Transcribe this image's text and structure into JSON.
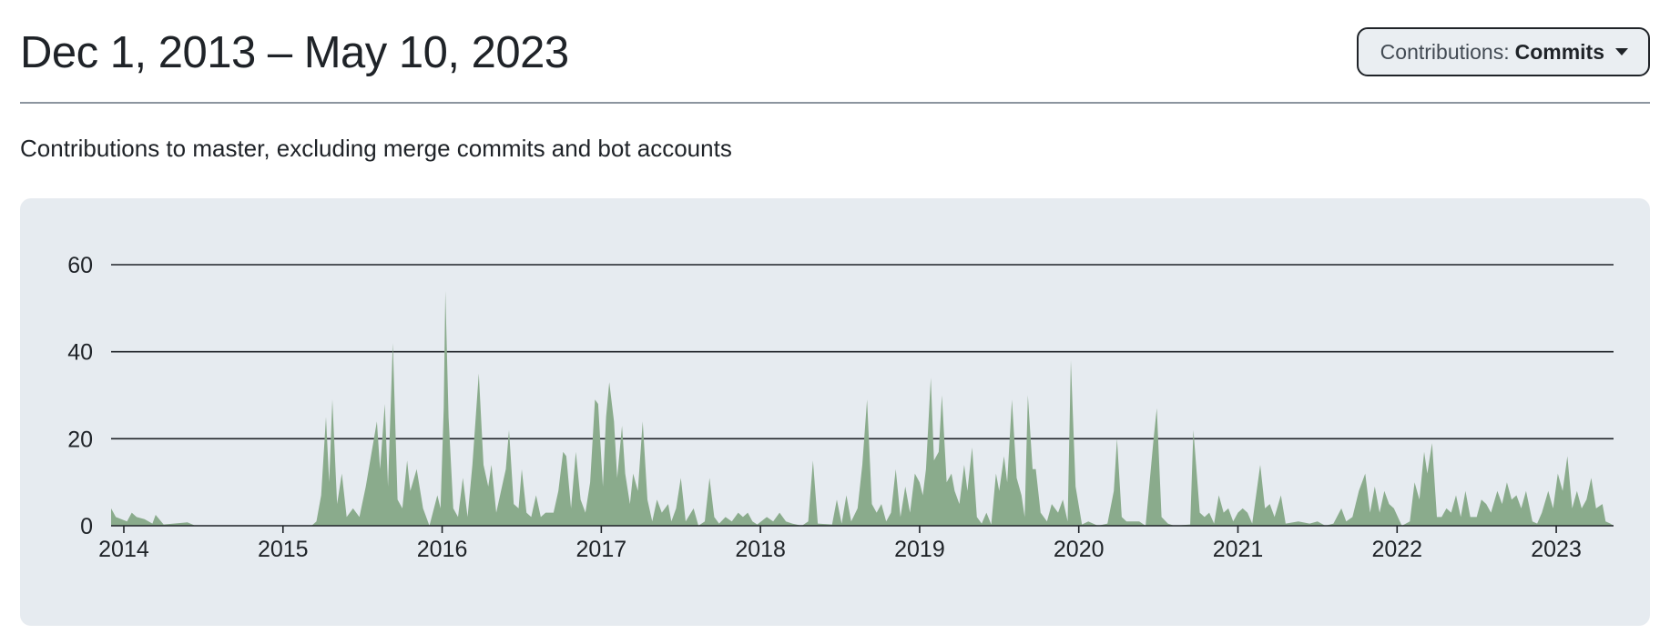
{
  "header": {
    "date_range": "Dec 1, 2013 – May 10, 2023",
    "dropdown": {
      "label": "Contributions:",
      "value": "Commits",
      "icon": "caret-down-icon"
    }
  },
  "subtitle": "Contributions to master, excluding merge commits and bot accounts",
  "colors": {
    "area": "#8aab8c",
    "panel": "#e6ebf0",
    "grid": "#1f2328"
  },
  "chart_data": {
    "type": "area",
    "title": "",
    "xlabel": "",
    "ylabel": "",
    "xlim": [
      2013.92,
      2023.36
    ],
    "ylim": [
      0,
      60
    ],
    "grid": true,
    "legend": "none",
    "y_ticks": [
      0,
      20,
      40,
      60
    ],
    "x_ticks": [
      2014,
      2015,
      2016,
      2017,
      2018,
      2019,
      2020,
      2021,
      2022,
      2023
    ],
    "x_tick_labels": [
      "2014",
      "2015",
      "2016",
      "2017",
      "2018",
      "2019",
      "2020",
      "2021",
      "2022",
      "2023"
    ],
    "series": [
      {
        "values": [
          [
            2013.92,
            4
          ],
          [
            2013.95,
            2
          ],
          [
            2014.02,
            1
          ],
          [
            2014.05,
            3
          ],
          [
            2014.08,
            2
          ],
          [
            2014.13,
            1.5
          ],
          [
            2014.18,
            0.5
          ],
          [
            2014.2,
            2.5
          ],
          [
            2014.25,
            0.3
          ],
          [
            2014.4,
            0.8
          ],
          [
            2014.45,
            0
          ],
          [
            2015.18,
            0
          ],
          [
            2015.21,
            1
          ],
          [
            2015.24,
            7
          ],
          [
            2015.27,
            25
          ],
          [
            2015.29,
            10
          ],
          [
            2015.31,
            29
          ],
          [
            2015.34,
            5
          ],
          [
            2015.37,
            12
          ],
          [
            2015.4,
            2
          ],
          [
            2015.44,
            4
          ],
          [
            2015.48,
            2
          ],
          [
            2015.52,
            9
          ],
          [
            2015.59,
            24
          ],
          [
            2015.61,
            13
          ],
          [
            2015.64,
            28
          ],
          [
            2015.66,
            9
          ],
          [
            2015.69,
            42
          ],
          [
            2015.72,
            6
          ],
          [
            2015.75,
            4
          ],
          [
            2015.78,
            15
          ],
          [
            2015.8,
            8
          ],
          [
            2015.84,
            13
          ],
          [
            2015.88,
            4
          ],
          [
            2015.92,
            0
          ],
          [
            2015.97,
            7
          ],
          [
            2015.99,
            4
          ],
          [
            2016.01,
            27
          ],
          [
            2016.02,
            54
          ],
          [
            2016.04,
            25
          ],
          [
            2016.07,
            4
          ],
          [
            2016.1,
            2
          ],
          [
            2016.13,
            11
          ],
          [
            2016.16,
            2
          ],
          [
            2016.19,
            14
          ],
          [
            2016.23,
            35
          ],
          [
            2016.26,
            14
          ],
          [
            2016.29,
            9
          ],
          [
            2016.31,
            14
          ],
          [
            2016.34,
            3
          ],
          [
            2016.37,
            8
          ],
          [
            2016.4,
            13
          ],
          [
            2016.42,
            22
          ],
          [
            2016.45,
            5
          ],
          [
            2016.48,
            4
          ],
          [
            2016.5,
            13
          ],
          [
            2016.53,
            3
          ],
          [
            2016.56,
            2
          ],
          [
            2016.59,
            7
          ],
          [
            2016.62,
            2
          ],
          [
            2016.65,
            3
          ],
          [
            2016.7,
            3
          ],
          [
            2016.73,
            8
          ],
          [
            2016.76,
            17
          ],
          [
            2016.78,
            16
          ],
          [
            2016.81,
            4
          ],
          [
            2016.84,
            17
          ],
          [
            2016.87,
            6
          ],
          [
            2016.9,
            3
          ],
          [
            2016.93,
            10
          ],
          [
            2016.96,
            29
          ],
          [
            2016.98,
            28
          ],
          [
            2017.01,
            9
          ],
          [
            2017.03,
            25
          ],
          [
            2017.05,
            33
          ],
          [
            2017.08,
            24
          ],
          [
            2017.1,
            11
          ],
          [
            2017.13,
            23
          ],
          [
            2017.15,
            12
          ],
          [
            2017.18,
            5
          ],
          [
            2017.2,
            12
          ],
          [
            2017.23,
            8
          ],
          [
            2017.26,
            24
          ],
          [
            2017.29,
            6
          ],
          [
            2017.32,
            1
          ],
          [
            2017.35,
            6
          ],
          [
            2017.38,
            3
          ],
          [
            2017.42,
            5
          ],
          [
            2017.44,
            1
          ],
          [
            2017.47,
            4
          ],
          [
            2017.5,
            11
          ],
          [
            2017.53,
            1
          ],
          [
            2017.58,
            4
          ],
          [
            2017.61,
            0
          ],
          [
            2017.65,
            1
          ],
          [
            2017.68,
            11
          ],
          [
            2017.71,
            2
          ],
          [
            2017.74,
            0.5
          ],
          [
            2017.78,
            2
          ],
          [
            2017.82,
            1
          ],
          [
            2017.86,
            3
          ],
          [
            2017.89,
            2
          ],
          [
            2017.92,
            3
          ],
          [
            2017.95,
            1
          ],
          [
            2017.98,
            0.3
          ],
          [
            2018.04,
            2
          ],
          [
            2018.08,
            1
          ],
          [
            2018.12,
            3
          ],
          [
            2018.16,
            1
          ],
          [
            2018.2,
            0.5
          ],
          [
            2018.26,
            0
          ],
          [
            2018.3,
            1
          ],
          [
            2018.33,
            15
          ],
          [
            2018.36,
            0.5
          ],
          [
            2018.45,
            0.3
          ],
          [
            2018.48,
            6
          ],
          [
            2018.51,
            0.5
          ],
          [
            2018.54,
            7
          ],
          [
            2018.57,
            1
          ],
          [
            2018.61,
            4
          ],
          [
            2018.64,
            14
          ],
          [
            2018.67,
            29
          ],
          [
            2018.7,
            5
          ],
          [
            2018.73,
            3
          ],
          [
            2018.76,
            5
          ],
          [
            2018.79,
            1
          ],
          [
            2018.82,
            3
          ],
          [
            2018.85,
            13
          ],
          [
            2018.88,
            2
          ],
          [
            2018.91,
            9
          ],
          [
            2018.94,
            3
          ],
          [
            2018.97,
            12
          ],
          [
            2019,
            10
          ],
          [
            2019.02,
            7
          ],
          [
            2019.04,
            13
          ],
          [
            2019.07,
            34
          ],
          [
            2019.09,
            15
          ],
          [
            2019.12,
            17
          ],
          [
            2019.14,
            30
          ],
          [
            2019.17,
            10
          ],
          [
            2019.2,
            12
          ],
          [
            2019.22,
            8
          ],
          [
            2019.25,
            5
          ],
          [
            2019.28,
            14
          ],
          [
            2019.3,
            8
          ],
          [
            2019.33,
            18
          ],
          [
            2019.36,
            2
          ],
          [
            2019.39,
            0.5
          ],
          [
            2019.42,
            3
          ],
          [
            2019.45,
            0.3
          ],
          [
            2019.48,
            12
          ],
          [
            2019.5,
            8
          ],
          [
            2019.53,
            16
          ],
          [
            2019.55,
            10
          ],
          [
            2019.58,
            29
          ],
          [
            2019.61,
            11
          ],
          [
            2019.64,
            7
          ],
          [
            2019.66,
            2
          ],
          [
            2019.68,
            30
          ],
          [
            2019.71,
            13
          ],
          [
            2019.73,
            13
          ],
          [
            2019.76,
            3
          ],
          [
            2019.8,
            1
          ],
          [
            2019.83,
            5
          ],
          [
            2019.87,
            3
          ],
          [
            2019.9,
            6
          ],
          [
            2019.93,
            1
          ],
          [
            2019.95,
            38
          ],
          [
            2019.98,
            9
          ],
          [
            2020.02,
            0.3
          ],
          [
            2020.06,
            1
          ],
          [
            2020.12,
            0
          ],
          [
            2020.18,
            0.5
          ],
          [
            2020.22,
            8
          ],
          [
            2020.24,
            20
          ],
          [
            2020.27,
            2
          ],
          [
            2020.3,
            1
          ],
          [
            2020.34,
            1
          ],
          [
            2020.38,
            1
          ],
          [
            2020.42,
            0
          ],
          [
            2020.47,
            20
          ],
          [
            2020.49,
            27
          ],
          [
            2020.52,
            2
          ],
          [
            2020.56,
            0.5
          ],
          [
            2020.6,
            0
          ],
          [
            2020.7,
            0.3
          ],
          [
            2020.72,
            22
          ],
          [
            2020.76,
            3
          ],
          [
            2020.79,
            2
          ],
          [
            2020.82,
            3
          ],
          [
            2020.85,
            0.5
          ],
          [
            2020.88,
            7
          ],
          [
            2020.91,
            3
          ],
          [
            2020.94,
            4
          ],
          [
            2020.97,
            1
          ],
          [
            2021,
            3
          ],
          [
            2021.03,
            4
          ],
          [
            2021.06,
            3
          ],
          [
            2021.09,
            0.5
          ],
          [
            2021.14,
            14
          ],
          [
            2021.17,
            4
          ],
          [
            2021.2,
            5
          ],
          [
            2021.23,
            2
          ],
          [
            2021.27,
            7
          ],
          [
            2021.3,
            0.5
          ],
          [
            2021.38,
            1
          ],
          [
            2021.45,
            0.5
          ],
          [
            2021.5,
            1
          ],
          [
            2021.55,
            0
          ],
          [
            2021.6,
            0.5
          ],
          [
            2021.65,
            4
          ],
          [
            2021.68,
            1
          ],
          [
            2021.72,
            2
          ],
          [
            2021.76,
            8
          ],
          [
            2021.8,
            12
          ],
          [
            2021.83,
            3
          ],
          [
            2021.86,
            9
          ],
          [
            2021.89,
            3
          ],
          [
            2021.92,
            8
          ],
          [
            2021.95,
            5
          ],
          [
            2021.98,
            4
          ],
          [
            2022.03,
            0
          ],
          [
            2022.08,
            1
          ],
          [
            2022.11,
            10
          ],
          [
            2022.14,
            6
          ],
          [
            2022.17,
            17
          ],
          [
            2022.19,
            12
          ],
          [
            2022.22,
            19
          ],
          [
            2022.25,
            2
          ],
          [
            2022.28,
            2
          ],
          [
            2022.31,
            4
          ],
          [
            2022.34,
            3
          ],
          [
            2022.37,
            7
          ],
          [
            2022.4,
            2
          ],
          [
            2022.43,
            8
          ],
          [
            2022.46,
            2
          ],
          [
            2022.5,
            2
          ],
          [
            2022.53,
            6
          ],
          [
            2022.56,
            5
          ],
          [
            2022.59,
            3
          ],
          [
            2022.63,
            8
          ],
          [
            2022.66,
            5
          ],
          [
            2022.69,
            10
          ],
          [
            2022.72,
            6
          ],
          [
            2022.75,
            7
          ],
          [
            2022.78,
            4
          ],
          [
            2022.81,
            8
          ],
          [
            2022.85,
            1
          ],
          [
            2022.88,
            0.5
          ],
          [
            2022.91,
            3
          ],
          [
            2022.95,
            8
          ],
          [
            2022.98,
            4
          ],
          [
            2023.01,
            12
          ],
          [
            2023.04,
            8
          ],
          [
            2023.07,
            16
          ],
          [
            2023.1,
            4
          ],
          [
            2023.13,
            8
          ],
          [
            2023.16,
            4
          ],
          [
            2023.19,
            6
          ],
          [
            2023.22,
            11
          ],
          [
            2023.25,
            4
          ],
          [
            2023.29,
            5
          ],
          [
            2023.31,
            1
          ],
          [
            2023.34,
            0.5
          ],
          [
            2023.36,
            0
          ]
        ]
      }
    ]
  }
}
